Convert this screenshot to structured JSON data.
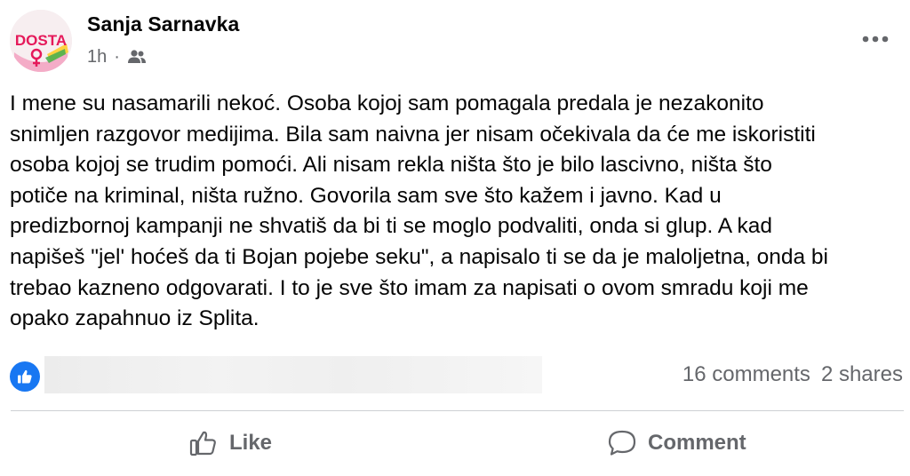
{
  "post": {
    "author": "Sanja Sarnavka",
    "time": "1h",
    "separator": "·",
    "avatar_text": "DOSTA",
    "text": "I mene su nasamarili nekoć. Osoba kojoj sam pomagala predala je nezakonito\nsnimljen razgovor medijima. Bila sam naivna jer nisam očekivala da će me iskoristiti\nosoba kojoj se trudim pomoći. Ali nisam rekla ništa što je bilo lascivno, ništa što\npotiče na kriminal, ništa ružno. Govorila sam sve što kažem i javno.  Kad u\npredizbornoj kampanji ne shvatiš da bi ti se moglo podvaliti, onda si glup. A kad\nnapišeš \"jel' hoćeš da ti Bojan pojebe seku\", a napisalo ti se da je maloljetna, onda bi\ntrebao kazneno odgovarati. I to je sve što imam za napisati o ovom smradu koji me\nopako zapahnuo iz Splita."
  },
  "stats": {
    "comments": "16 comments",
    "shares": "2 shares"
  },
  "actions": {
    "like_label": "Like",
    "comment_label": "Comment"
  },
  "icons": {
    "audience": "friends-icon",
    "more": "more-options-icon",
    "reaction": "like-reaction-icon",
    "like": "thumbs-up-icon",
    "comment": "comment-bubble-icon"
  },
  "colors": {
    "accent": "#1877f2",
    "secondary_text": "#65676b",
    "divider": "#ced0d4",
    "avatar_brand": "#e5195a"
  }
}
